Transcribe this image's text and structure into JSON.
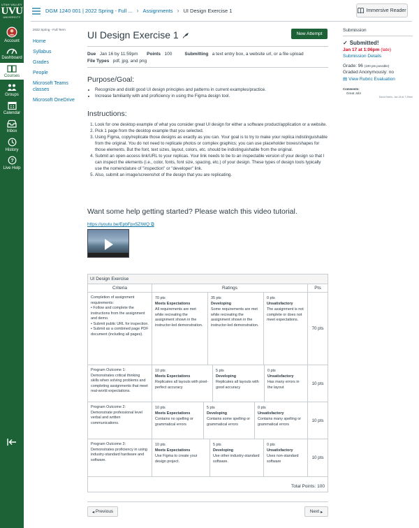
{
  "global_nav": {
    "logo": {
      "top": "UTAH VALLEY",
      "main": "UVU",
      "bottom": "UNIVERSITY"
    },
    "items": [
      {
        "label": "Account",
        "icon": "account-avatar-icon"
      },
      {
        "label": "Dashboard",
        "icon": "dashboard-icon"
      },
      {
        "label": "Courses",
        "icon": "courses-icon"
      },
      {
        "label": "Groups",
        "icon": "groups-icon"
      },
      {
        "label": "Calendar",
        "icon": "calendar-icon"
      },
      {
        "label": "Inbox",
        "icon": "inbox-icon"
      },
      {
        "label": "History",
        "icon": "history-icon"
      },
      {
        "label": "Live Help",
        "icon": "help-icon"
      }
    ],
    "active": "Courses",
    "colors": {
      "brand": "#1d6236",
      "link": "#0770a3",
      "late": "#e0061f"
    }
  },
  "header": {
    "breadcrumbs": [
      "DGM 1240 001 | 2022 Spring - Full ...",
      "Assignments",
      "UI Design Exercise 1"
    ],
    "immersive_reader": "Immersive Reader"
  },
  "course_nav": {
    "term": "2022 Spring - Full Term",
    "items": [
      "Home",
      "Syllabus",
      "Grades",
      "People",
      "Microsoft Teams classes",
      "Microsoft OneDrive"
    ]
  },
  "assignment": {
    "title": "UI Design Exercise 1",
    "new_attempt": "New Attempt",
    "due_label": "Due",
    "due_value": "Jan 16 by 11:59pm",
    "points_label": "Points",
    "points_value": "100",
    "submitting_label": "Submitting",
    "submitting_value": "a text entry box, a website url, or a file upload",
    "file_types_label": "File Types",
    "file_types_value": "pdf, jpg, and png",
    "purpose_heading": "Purpose/Goal:",
    "purpose_items": [
      "Recognize and distill good UI design principles and patterns in current examples/practice.",
      "Increase familiarity with and proficiency in using the Figma design tool."
    ],
    "instructions_heading": "Instructions:",
    "instructions": [
      "Look for one desktop example of what you consider great UI design for either a software product/application or a website.",
      "Pick 1 page from the desktop example that you selected.",
      "Using Figma, copy/replicate those designs as exactly as you can. Your goal is to try to make your replica indistinguishable from the original. You do not need to replicate photos or complex graphics; you can use placeholder boxes/shapes for those elements. But the font, text sizes, layout, colors, etc. should be indistinguishable from the original.",
      "Submit an open-access link/URL to your replicas. Your link needs to be to an inspectable version of your design so that I can inspect the elements (i.e., color, fonts, font size, spacing, etc.) of your design. These types of design tools typically use the nomenclature of \"inspection\" or \"developer\" link.",
      "Also, submit an image/screenshot of the design that you are replicating."
    ],
    "video_heading": "Want some help getting started? Please watch this video tutorial.",
    "video_link": "https://youtu.be/EpbFpx5ZIWQ"
  },
  "rubric": {
    "title": "UI Design Exercise",
    "col_criteria": "Criteria",
    "col_ratings": "Ratings",
    "col_pts": "Pts",
    "rows": [
      {
        "criteria": [
          "Completion of assignment requirements:",
          "• Follow and complete the instructions from the assignment and demo.",
          "• Submit public URL for inspection.",
          "• Submit as a combined page PDF document (including all pages)."
        ],
        "ratings": [
          {
            "pts": "70 pts",
            "name": "Meets Expectations",
            "desc": "All requirements are met while recreating the assignment shown in the instructor-led demonstration."
          },
          {
            "pts": "35 pts",
            "name": "Developing",
            "desc": "Some requirements are met while recreating the assignment shown in the instructor-led demonstration."
          },
          {
            "pts": "0 pts",
            "name": "Unsatisfactory",
            "desc": "The assignment is not complete or does not meet expectations."
          }
        ],
        "points": "70 pts"
      },
      {
        "criteria": [
          "Program Outcome 1:",
          "Demonstrates critical thinking skills when solving problems and completing assignments that meet real-world expectations."
        ],
        "ratings": [
          {
            "pts": "10 pts",
            "name": "Meets Expectations",
            "desc": "Replicates all layouts with pixel-perfect accuracy"
          },
          {
            "pts": "5 pts",
            "name": "Developing",
            "desc": "Replicates all layouts with good accuracy"
          },
          {
            "pts": "0 pts",
            "name": "Unsatisfactory",
            "desc": "Has many errors in the layout"
          }
        ],
        "points": "10 pts"
      },
      {
        "criteria": [
          "Program Outcome 2:",
          "Demonstrate professional level verbal and written communications."
        ],
        "ratings": [
          {
            "pts": "10 pts",
            "name": "Meets Expectations",
            "desc": "Contains no spelling or grammatical errors"
          },
          {
            "pts": "5 pts",
            "name": "Developing",
            "desc": "Contains some spelling or grammatical errors"
          },
          {
            "pts": "0 pts",
            "name": "Unsatisfactory",
            "desc": "Contains many spelling or grammatical errors"
          }
        ],
        "points": "10 pts"
      },
      {
        "criteria": [
          "Program Outcome 3:",
          "Demonstrates proficiency in using industry-standard hardware and software."
        ],
        "ratings": [
          {
            "pts": "10 pts",
            "name": "Meets Expectations",
            "desc": "Use Figma to create your design project."
          },
          {
            "pts": "5 pts",
            "name": "Developing",
            "desc": "Use other industry-standard software."
          },
          {
            "pts": "0 pts",
            "name": "Unsatisfactory",
            "desc": "Uses non-standard software"
          }
        ],
        "points": "10 pts"
      }
    ],
    "total": "Total Points: 100"
  },
  "footer": {
    "previous": "Previous",
    "next": "Next"
  },
  "sidebar": {
    "heading": "Submission",
    "status": "Submitted!",
    "submitted_at": "Jan 17 at 1:06pm",
    "late": "(late)",
    "details_link": "Submission Details",
    "grade_label": "Grade: 96",
    "grade_possible": "(100 pts possible)",
    "graded_anonymously": "Graded Anonymously: no",
    "rubric_link": "View Rubric Evaluation",
    "comments_label": "Comments:",
    "comment_text": "Great Job!",
    "comment_meta": "David Harris, Jan 18 at 7:29am"
  }
}
